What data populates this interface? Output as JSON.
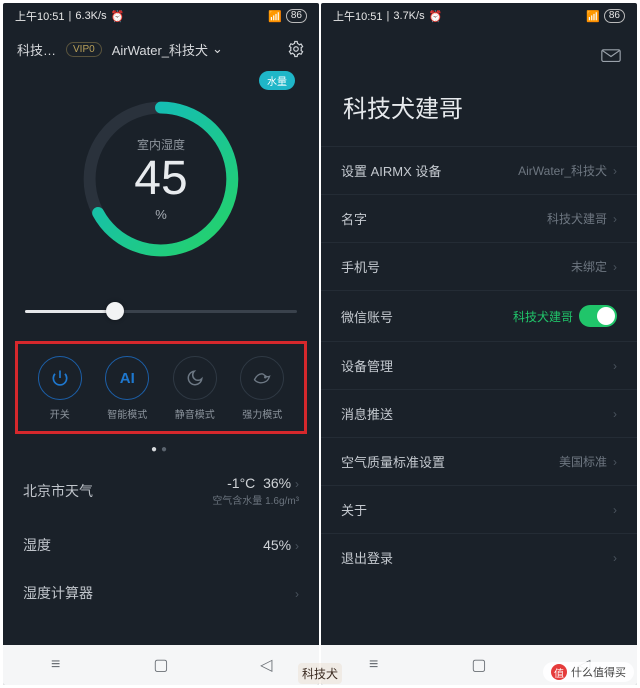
{
  "statusbar": {
    "time": "上午10:51",
    "net_left": "6.3K/s",
    "net_right": "3.7K/s",
    "alarm": "⏰",
    "signal": "📶",
    "battery": "86"
  },
  "left": {
    "header": {
      "title": "科技…",
      "vip": "VIP0",
      "device": "AirWater_科技犬"
    },
    "gauge": {
      "water_badge": "水量",
      "label": "室内湿度",
      "value": "45",
      "unit": "%"
    },
    "modes": [
      {
        "icon": "power",
        "label": "开关"
      },
      {
        "icon": "ai",
        "label": "智能模式"
      },
      {
        "icon": "moon",
        "label": "静音模式"
      },
      {
        "icon": "whale",
        "label": "强力模式"
      }
    ],
    "rows": {
      "city": "北京市天气",
      "temp": "-1°C",
      "hum_city": "36%",
      "air_sub": "空气含水量 1.6g/m³",
      "humidity_label": "湿度",
      "humidity_val": "45%",
      "calc_label": "湿度计算器"
    }
  },
  "right": {
    "title": "科技犬建哥",
    "rows": [
      {
        "label": "设置 AIRMX 设备",
        "value": "AirWater_科技犬",
        "chev": true
      },
      {
        "label": "名字",
        "value": "科技犬建哥",
        "chev": true
      },
      {
        "label": "手机号",
        "value": "未绑定",
        "chev": true
      },
      {
        "label": "微信账号",
        "value": "科技犬建哥",
        "toggle": true,
        "green": true
      },
      {
        "label": "设备管理",
        "value": "",
        "chev": true
      },
      {
        "label": "消息推送",
        "value": "",
        "chev": true
      },
      {
        "label": "空气质量标准设置",
        "value": "美国标准",
        "chev": true
      },
      {
        "label": "关于",
        "value": "",
        "chev": true
      },
      {
        "label": "退出登录",
        "value": "",
        "chev": true
      }
    ]
  },
  "watermark": {
    "text": "什么值得买",
    "ball": "值"
  },
  "sticker": "科技犬"
}
